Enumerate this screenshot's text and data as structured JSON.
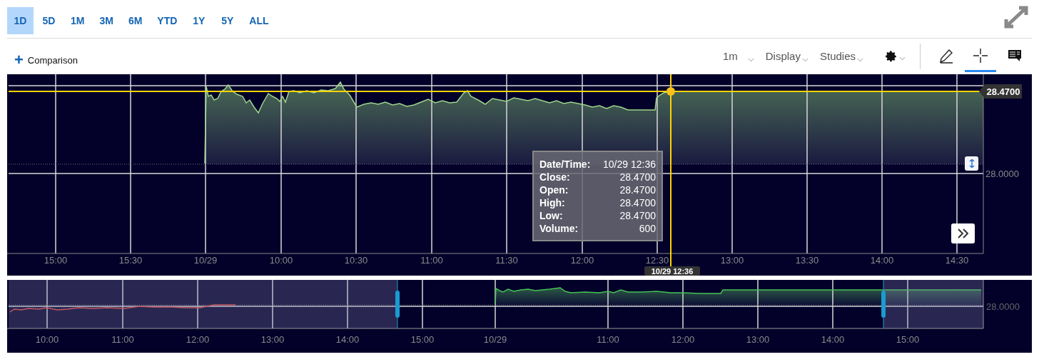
{
  "ranges": [
    {
      "label": "1D",
      "selected": true
    },
    {
      "label": "5D",
      "selected": false
    },
    {
      "label": "1M",
      "selected": false
    },
    {
      "label": "3M",
      "selected": false
    },
    {
      "label": "6M",
      "selected": false
    },
    {
      "label": "YTD",
      "selected": false
    },
    {
      "label": "1Y",
      "selected": false
    },
    {
      "label": "5Y",
      "selected": false
    },
    {
      "label": "ALL",
      "selected": false
    }
  ],
  "toolbar": {
    "comparison": {
      "icon": "+",
      "label": "Comparison"
    },
    "interval": "1m",
    "menus": [
      "Display",
      "Studies"
    ],
    "tools": [
      {
        "kind": "draw",
        "selected": false
      },
      {
        "kind": "crosshair",
        "selected": true
      },
      {
        "kind": "comments",
        "selected": false
      }
    ]
  },
  "chart": {
    "x_labels": [
      "15:00",
      "15:30",
      "10/29",
      "10:00",
      "10:30",
      "11:00",
      "11:30",
      "12:00",
      "12:30",
      "13:00",
      "13:30",
      "14:00",
      "14:30"
    ],
    "y_label": "28.0000",
    "price_badge": "28.4700",
    "crosshair_label": "10/29 12:36",
    "tooltip": [
      {
        "label": "Date/Time:",
        "value": "10/29 12:36"
      },
      {
        "label": "Close:",
        "value": "28.4700"
      },
      {
        "label": "Open:",
        "value": "28.4700"
      },
      {
        "label": "High:",
        "value": "28.4700"
      },
      {
        "label": "Low:",
        "value": "28.4700"
      },
      {
        "label": "Volume:",
        "value": "600"
      }
    ]
  },
  "navigator": {
    "x_labels": [
      "10:00",
      "11:00",
      "12:00",
      "13:00",
      "14:00",
      "15:00",
      "10/29",
      "11:00",
      "12:00",
      "13:00",
      "14:00",
      "15:00"
    ],
    "y_label": "28.0000"
  }
}
